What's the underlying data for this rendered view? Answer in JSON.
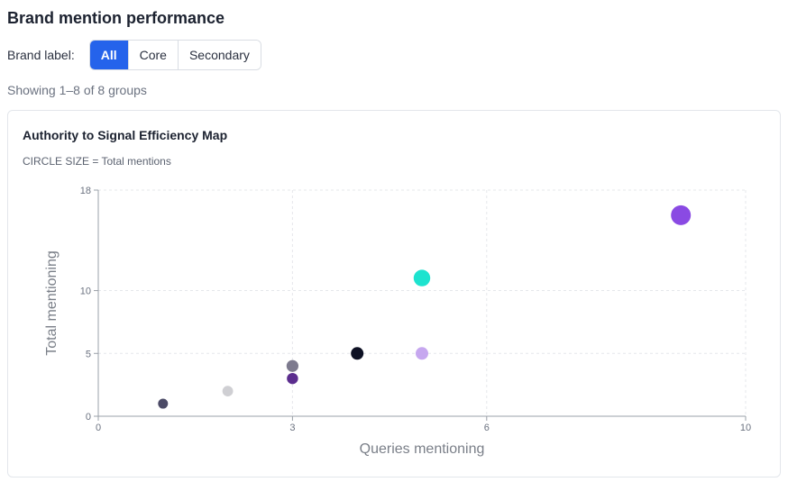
{
  "header": {
    "title": "Brand mention performance"
  },
  "filter": {
    "label": "Brand label:",
    "options": [
      "All",
      "Core",
      "Secondary"
    ],
    "selected": "All"
  },
  "status": {
    "showing": "Showing 1–8 of 8 groups"
  },
  "colors": {
    "accent": "#2563eb"
  },
  "chart_data": {
    "type": "scatter",
    "title": "Authority to Signal Efficiency Map",
    "subtitle": "CIRCLE SIZE = Total mentions",
    "xlabel": "Queries mentioning",
    "ylabel": "Total mentioning",
    "xlim": [
      0,
      10
    ],
    "ylim": [
      0,
      18
    ],
    "xticks": [
      0,
      3,
      6,
      10
    ],
    "yticks": [
      0,
      5,
      10,
      18
    ],
    "grid": true,
    "size_encoding": "Total mentions",
    "points": [
      {
        "x": 1,
        "y": 1,
        "size": 1,
        "color": "#4b4a66"
      },
      {
        "x": 2,
        "y": 2,
        "size": 2,
        "color": "#cfcfd3"
      },
      {
        "x": 3,
        "y": 4,
        "size": 4,
        "color": "#7d7a8e"
      },
      {
        "x": 3,
        "y": 3,
        "size": 3,
        "color": "#5b2d8e"
      },
      {
        "x": 4,
        "y": 5,
        "size": 5,
        "color": "#0e1124"
      },
      {
        "x": 5,
        "y": 5,
        "size": 5,
        "color": "#c6a7ef"
      },
      {
        "x": 5,
        "y": 11,
        "size": 11,
        "color": "#1de3cf"
      },
      {
        "x": 9,
        "y": 16,
        "size": 16,
        "color": "#8a4ae3"
      }
    ]
  }
}
